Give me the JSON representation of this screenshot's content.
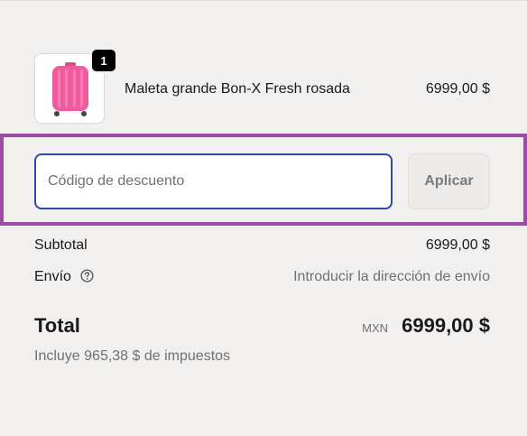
{
  "product": {
    "image_icon": "suitcase-pink-image",
    "quantity": "1",
    "name": "Maleta grande Bon-X Fresh rosada",
    "price": "6999,00 $"
  },
  "discount": {
    "placeholder": "Código de descuento",
    "apply_label": "Aplicar"
  },
  "summary": {
    "subtotal_label": "Subtotal",
    "subtotal_value": "6999,00 $",
    "shipping_label": "Envío",
    "shipping_value": "Introducir la dirección de envío",
    "help_icon": "question-circle-icon",
    "total_label": "Total",
    "currency": "MXN",
    "total_value": "6999,00 $",
    "taxes_note": "Incluye 965,38 $ de impuestos"
  },
  "colors": {
    "background": "#f1f0ef",
    "highlight_border": "#9b4ea1",
    "input_focus_border": "#2f4b9d",
    "product_pink": "#ef5b9c"
  }
}
